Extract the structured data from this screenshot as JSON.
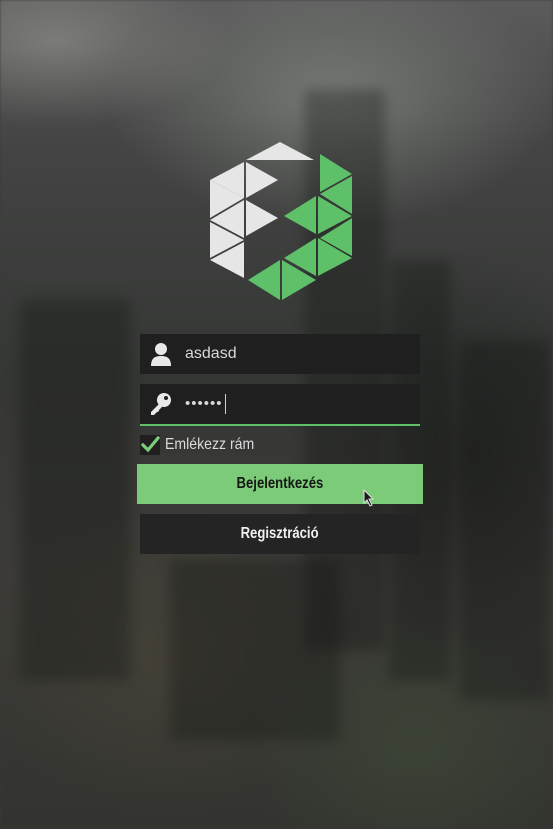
{
  "login_form": {
    "username_value": "asdasd",
    "password_value": "••••••",
    "remember_label": "Emlékezz rám",
    "remember_checked": true,
    "login_label": "Bejelentkezés",
    "register_label": "Regisztráció"
  },
  "icons": {
    "logo": "hexagon-triangle-logo-icon",
    "username": "user-icon",
    "password": "key-icon",
    "check": "checkmark-icon",
    "cursor": "mouse-pointer-icon"
  },
  "colors": {
    "accent": "#7ccb78",
    "logo_green": "#5ec16a",
    "logo_light": "#e6e6e6",
    "field_bg": "#1e1f1e"
  }
}
